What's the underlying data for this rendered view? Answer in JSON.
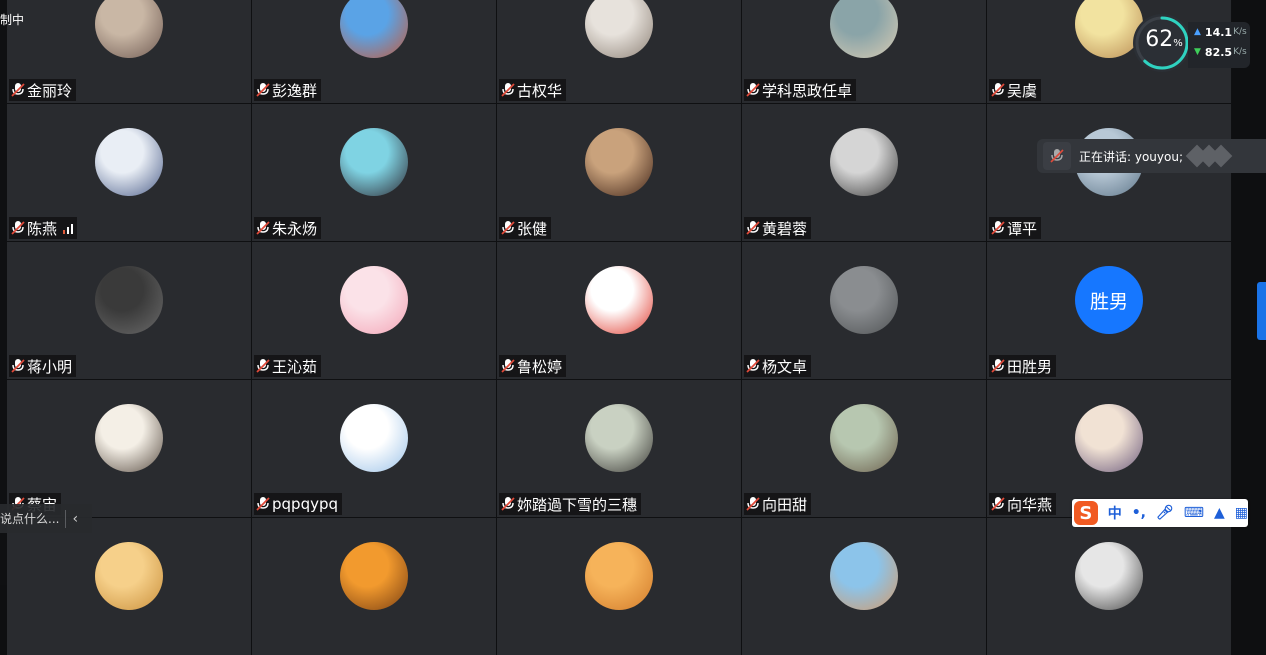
{
  "recording_label": "制中",
  "network": {
    "percent": "62",
    "percent_unit": "%",
    "upload": "14.1",
    "download": "82.5",
    "unit": "K/s",
    "level": 0.62
  },
  "speaking": {
    "text": "正在讲话: youyou;"
  },
  "chat": {
    "placeholder": "说点什么..."
  },
  "ime": {
    "logo": "S",
    "mode": "中",
    "punct": "•,"
  },
  "participants": [
    {
      "name": "金丽玲",
      "avatar": [
        "#c9b7a5",
        "#6f5a52"
      ]
    },
    {
      "name": "彭逸群",
      "avatar": [
        "#5aa3e6",
        "#c45a3b"
      ]
    },
    {
      "name": "古权华",
      "avatar": [
        "#e7e2dc",
        "#8d8176"
      ]
    },
    {
      "name": "学科思政任卓",
      "avatar": [
        "#8aa4a8",
        "#d9ccb4"
      ]
    },
    {
      "name": "吴虞",
      "avatar": [
        "#f2e3a0",
        "#b88a52"
      ]
    },
    {
      "name": "陈燕",
      "avatar": [
        "#e9eef5",
        "#4d5f8a"
      ],
      "signal": true
    },
    {
      "name": "朱永炀",
      "avatar": [
        "#7fd3e3",
        "#2e2a33"
      ]
    },
    {
      "name": "张健",
      "avatar": [
        "#c9a27c",
        "#402418"
      ]
    },
    {
      "name": "黄碧蓉",
      "avatar": [
        "#d5d5d5",
        "#3a3a3a"
      ]
    },
    {
      "name": "谭平",
      "avatar": [
        "#b8c8d6",
        "#5d7588"
      ]
    },
    {
      "name": "蒋小明",
      "avatar": [
        "#3a3a3a",
        "#6b6b6b"
      ]
    },
    {
      "name": "王沁茹",
      "avatar": [
        "#fbe2e8",
        "#f3a3b5"
      ]
    },
    {
      "name": "鲁松婷",
      "avatar": [
        "#ffffff",
        "#e03a2e"
      ]
    },
    {
      "name": "杨文卓",
      "avatar": [
        "#8a8d90",
        "#4f5254"
      ]
    },
    {
      "name": "田胜男",
      "avatar_text": "胜男",
      "color": "#1677ff"
    },
    {
      "name": "蔡宙",
      "avatar": [
        "#f4efe6",
        "#5b4f45"
      ]
    },
    {
      "name": "pqpqypq",
      "avatar": [
        "#ffffff",
        "#9bc2e8"
      ]
    },
    {
      "name": "妳踏過下雪的三穗",
      "avatar": [
        "#c9d1c2",
        "#3b3a36"
      ]
    },
    {
      "name": "向田甜",
      "avatar": [
        "#b7c7b0",
        "#6a5d4a"
      ]
    },
    {
      "name": "向华燕",
      "avatar": [
        "#f1e2d4",
        "#6b5a7c"
      ]
    },
    {
      "name": "",
      "avatar": [
        "#f6d08a",
        "#c98f3b"
      ]
    },
    {
      "name": "",
      "avatar": [
        "#f29a2e",
        "#7a3f12"
      ]
    },
    {
      "name": "",
      "avatar": [
        "#f6b35a",
        "#d17a2a"
      ]
    },
    {
      "name": "",
      "avatar": [
        "#8cc4ea",
        "#d49a6a"
      ]
    },
    {
      "name": "",
      "avatar": [
        "#e6e6e6",
        "#444444"
      ]
    }
  ]
}
